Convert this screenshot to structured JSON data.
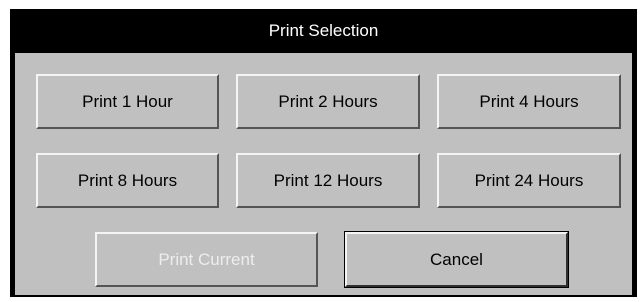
{
  "dialog": {
    "title": "Print Selection"
  },
  "buttons": {
    "print_1_hour": "Print 1 Hour",
    "print_2_hours": "Print 2 Hours",
    "print_4_hours": "Print 4 Hours",
    "print_8_hours": "Print 8 Hours",
    "print_12_hours": "Print 12 Hours",
    "print_24_hours": "Print 24 Hours",
    "print_current": "Print Current",
    "print_current_enabled": false,
    "cancel": "Cancel"
  },
  "colors": {
    "title_bar": "#000000",
    "title_text": "#ffffff",
    "panel_background": "#c0c0c0",
    "button_text": "#000000",
    "disabled_text": "#ededed"
  }
}
